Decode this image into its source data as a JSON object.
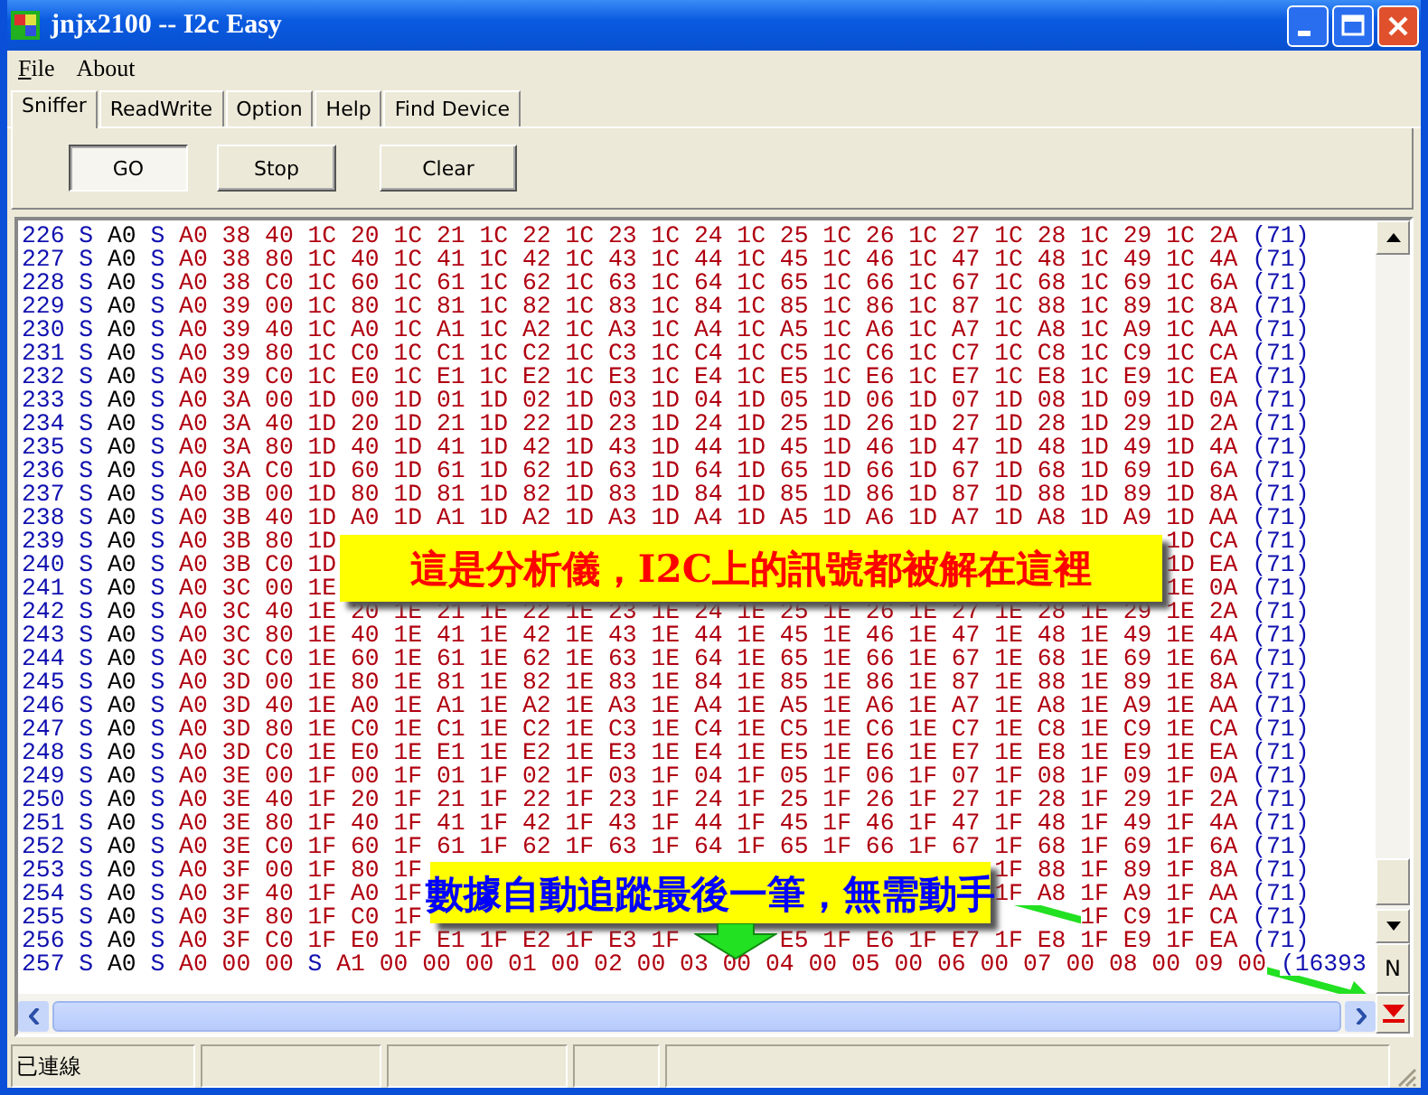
{
  "window": {
    "title": "jnjx2100 -- I2c Easy"
  },
  "menu": [
    {
      "label": "File",
      "underlined_first_letter": true
    },
    {
      "label": "About",
      "underlined_first_letter": false
    }
  ],
  "tabs": [
    {
      "label": "Sniffer",
      "selected": true
    },
    {
      "label": "ReadWrite",
      "selected": false
    },
    {
      "label": "Option",
      "selected": false
    },
    {
      "label": "Help",
      "selected": false
    },
    {
      "label": "Find Device",
      "selected": false
    }
  ],
  "buttons": [
    {
      "label": "GO",
      "pressed": true
    },
    {
      "label": "Stop",
      "pressed": false
    },
    {
      "label": "Clear",
      "pressed": false
    }
  ],
  "log": {
    "rows": [
      {
        "number": "226",
        "head": [
          {
            "kind": "mark",
            "text": "S"
          },
          {
            "kind": "address",
            "text": "A0"
          },
          {
            "kind": "mark",
            "text": "S"
          },
          {
            "kind": "data",
            "text": "A0 38 40 1C 20 1C 21 1C 22 1C 23 1C 24 1C 25 1C 26 1C 27 1C 28 1C 29 1C 2A"
          },
          {
            "kind": "count",
            "text": "(71)"
          }
        ]
      },
      {
        "number": "227",
        "head": [
          {
            "kind": "mark",
            "text": "S"
          },
          {
            "kind": "address",
            "text": "A0"
          },
          {
            "kind": "mark",
            "text": "S"
          },
          {
            "kind": "data",
            "text": "A0 38 80 1C 40 1C 41 1C 42 1C 43 1C 44 1C 45 1C 46 1C 47 1C 48 1C 49 1C 4A"
          },
          {
            "kind": "count",
            "text": "(71)"
          }
        ]
      },
      {
        "number": "228",
        "head": [
          {
            "kind": "mark",
            "text": "S"
          },
          {
            "kind": "address",
            "text": "A0"
          },
          {
            "kind": "mark",
            "text": "S"
          },
          {
            "kind": "data",
            "text": "A0 38 C0 1C 60 1C 61 1C 62 1C 63 1C 64 1C 65 1C 66 1C 67 1C 68 1C 69 1C 6A"
          },
          {
            "kind": "count",
            "text": "(71)"
          }
        ]
      },
      {
        "number": "229",
        "head": [
          {
            "kind": "mark",
            "text": "S"
          },
          {
            "kind": "address",
            "text": "A0"
          },
          {
            "kind": "mark",
            "text": "S"
          },
          {
            "kind": "data",
            "text": "A0 39 00 1C 80 1C 81 1C 82 1C 83 1C 84 1C 85 1C 86 1C 87 1C 88 1C 89 1C 8A"
          },
          {
            "kind": "count",
            "text": "(71)"
          }
        ]
      },
      {
        "number": "230",
        "head": [
          {
            "kind": "mark",
            "text": "S"
          },
          {
            "kind": "address",
            "text": "A0"
          },
          {
            "kind": "mark",
            "text": "S"
          },
          {
            "kind": "data",
            "text": "A0 39 40 1C A0 1C A1 1C A2 1C A3 1C A4 1C A5 1C A6 1C A7 1C A8 1C A9 1C AA"
          },
          {
            "kind": "count",
            "text": "(71)"
          }
        ]
      },
      {
        "number": "231",
        "head": [
          {
            "kind": "mark",
            "text": "S"
          },
          {
            "kind": "address",
            "text": "A0"
          },
          {
            "kind": "mark",
            "text": "S"
          },
          {
            "kind": "data",
            "text": "A0 39 80 1C C0 1C C1 1C C2 1C C3 1C C4 1C C5 1C C6 1C C7 1C C8 1C C9 1C CA"
          },
          {
            "kind": "count",
            "text": "(71)"
          }
        ]
      },
      {
        "number": "232",
        "head": [
          {
            "kind": "mark",
            "text": "S"
          },
          {
            "kind": "address",
            "text": "A0"
          },
          {
            "kind": "mark",
            "text": "S"
          },
          {
            "kind": "data",
            "text": "A0 39 C0 1C E0 1C E1 1C E2 1C E3 1C E4 1C E5 1C E6 1C E7 1C E8 1C E9 1C EA"
          },
          {
            "kind": "count",
            "text": "(71)"
          }
        ]
      },
      {
        "number": "233",
        "head": [
          {
            "kind": "mark",
            "text": "S"
          },
          {
            "kind": "address",
            "text": "A0"
          },
          {
            "kind": "mark",
            "text": "S"
          },
          {
            "kind": "data",
            "text": "A0 3A 00 1D 00 1D 01 1D 02 1D 03 1D 04 1D 05 1D 06 1D 07 1D 08 1D 09 1D 0A"
          },
          {
            "kind": "count",
            "text": "(71)"
          }
        ]
      },
      {
        "number": "234",
        "head": [
          {
            "kind": "mark",
            "text": "S"
          },
          {
            "kind": "address",
            "text": "A0"
          },
          {
            "kind": "mark",
            "text": "S"
          },
          {
            "kind": "data",
            "text": "A0 3A 40 1D 20 1D 21 1D 22 1D 23 1D 24 1D 25 1D 26 1D 27 1D 28 1D 29 1D 2A"
          },
          {
            "kind": "count",
            "text": "(71)"
          }
        ]
      },
      {
        "number": "235",
        "head": [
          {
            "kind": "mark",
            "text": "S"
          },
          {
            "kind": "address",
            "text": "A0"
          },
          {
            "kind": "mark",
            "text": "S"
          },
          {
            "kind": "data",
            "text": "A0 3A 80 1D 40 1D 41 1D 42 1D 43 1D 44 1D 45 1D 46 1D 47 1D 48 1D 49 1D 4A"
          },
          {
            "kind": "count",
            "text": "(71)"
          }
        ]
      },
      {
        "number": "236",
        "head": [
          {
            "kind": "mark",
            "text": "S"
          },
          {
            "kind": "address",
            "text": "A0"
          },
          {
            "kind": "mark",
            "text": "S"
          },
          {
            "kind": "data",
            "text": "A0 3A C0 1D 60 1D 61 1D 62 1D 63 1D 64 1D 65 1D 66 1D 67 1D 68 1D 69 1D 6A"
          },
          {
            "kind": "count",
            "text": "(71)"
          }
        ]
      },
      {
        "number": "237",
        "head": [
          {
            "kind": "mark",
            "text": "S"
          },
          {
            "kind": "address",
            "text": "A0"
          },
          {
            "kind": "mark",
            "text": "S"
          },
          {
            "kind": "data",
            "text": "A0 3B 00 1D 80 1D 81 1D 82 1D 83 1D 84 1D 85 1D 86 1D 87 1D 88 1D 89 1D 8A"
          },
          {
            "kind": "count",
            "text": "(71)"
          }
        ]
      },
      {
        "number": "238",
        "head": [
          {
            "kind": "mark",
            "text": "S"
          },
          {
            "kind": "address",
            "text": "A0"
          },
          {
            "kind": "mark",
            "text": "S"
          },
          {
            "kind": "data",
            "text": "A0 3B 40 1D A0 1D A1 1D A2 1D A3 1D A4 1D A5 1D A6 1D A7 1D A8 1D A9 1D AA"
          },
          {
            "kind": "count",
            "text": "(71)"
          }
        ]
      },
      {
        "number": "239",
        "head": [
          {
            "kind": "mark",
            "text": "S"
          },
          {
            "kind": "address",
            "text": "A0"
          },
          {
            "kind": "mark",
            "text": "S"
          },
          {
            "kind": "data",
            "text": "A0 3B 80 1D"
          }
        ],
        "tail": [
          {
            "kind": "data",
            "text": "1D CA"
          },
          {
            "kind": "count",
            "text": "(71)"
          }
        ]
      },
      {
        "number": "240",
        "head": [
          {
            "kind": "mark",
            "text": "S"
          },
          {
            "kind": "address",
            "text": "A0"
          },
          {
            "kind": "mark",
            "text": "S"
          },
          {
            "kind": "data",
            "text": "A0 3B C0 1D"
          }
        ],
        "tail": [
          {
            "kind": "data",
            "text": "1D EA"
          },
          {
            "kind": "count",
            "text": "(71)"
          }
        ]
      },
      {
        "number": "241",
        "head": [
          {
            "kind": "mark",
            "text": "S"
          },
          {
            "kind": "address",
            "text": "A0"
          },
          {
            "kind": "mark",
            "text": "S"
          },
          {
            "kind": "data",
            "text": "A0 3C 00 1E"
          }
        ],
        "tail": [
          {
            "kind": "data",
            "text": "1E 0A"
          },
          {
            "kind": "count",
            "text": "(71)"
          }
        ]
      },
      {
        "number": "242",
        "head": [
          {
            "kind": "mark",
            "text": "S"
          },
          {
            "kind": "address",
            "text": "A0"
          },
          {
            "kind": "mark",
            "text": "S"
          },
          {
            "kind": "data",
            "text": "A0 3C 40 1E 20 1E 21 1E 22 1E 23 1E 24 1E 25 1E 26 1E 27 1E 28 1E 29 1E 2A"
          },
          {
            "kind": "count",
            "text": "(71)"
          }
        ]
      },
      {
        "number": "243",
        "head": [
          {
            "kind": "mark",
            "text": "S"
          },
          {
            "kind": "address",
            "text": "A0"
          },
          {
            "kind": "mark",
            "text": "S"
          },
          {
            "kind": "data",
            "text": "A0 3C 80 1E 40 1E 41 1E 42 1E 43 1E 44 1E 45 1E 46 1E 47 1E 48 1E 49 1E 4A"
          },
          {
            "kind": "count",
            "text": "(71)"
          }
        ]
      },
      {
        "number": "244",
        "head": [
          {
            "kind": "mark",
            "text": "S"
          },
          {
            "kind": "address",
            "text": "A0"
          },
          {
            "kind": "mark",
            "text": "S"
          },
          {
            "kind": "data",
            "text": "A0 3C C0 1E 60 1E 61 1E 62 1E 63 1E 64 1E 65 1E 66 1E 67 1E 68 1E 69 1E 6A"
          },
          {
            "kind": "count",
            "text": "(71)"
          }
        ]
      },
      {
        "number": "245",
        "head": [
          {
            "kind": "mark",
            "text": "S"
          },
          {
            "kind": "address",
            "text": "A0"
          },
          {
            "kind": "mark",
            "text": "S"
          },
          {
            "kind": "data",
            "text": "A0 3D 00 1E 80 1E 81 1E 82 1E 83 1E 84 1E 85 1E 86 1E 87 1E 88 1E 89 1E 8A"
          },
          {
            "kind": "count",
            "text": "(71)"
          }
        ]
      },
      {
        "number": "246",
        "head": [
          {
            "kind": "mark",
            "text": "S"
          },
          {
            "kind": "address",
            "text": "A0"
          },
          {
            "kind": "mark",
            "text": "S"
          },
          {
            "kind": "data",
            "text": "A0 3D 40 1E A0 1E A1 1E A2 1E A3 1E A4 1E A5 1E A6 1E A7 1E A8 1E A9 1E AA"
          },
          {
            "kind": "count",
            "text": "(71)"
          }
        ]
      },
      {
        "number": "247",
        "head": [
          {
            "kind": "mark",
            "text": "S"
          },
          {
            "kind": "address",
            "text": "A0"
          },
          {
            "kind": "mark",
            "text": "S"
          },
          {
            "kind": "data",
            "text": "A0 3D 80 1E C0 1E C1 1E C2 1E C3 1E C4 1E C5 1E C6 1E C7 1E C8 1E C9 1E CA"
          },
          {
            "kind": "count",
            "text": "(71)"
          }
        ]
      },
      {
        "number": "248",
        "head": [
          {
            "kind": "mark",
            "text": "S"
          },
          {
            "kind": "address",
            "text": "A0"
          },
          {
            "kind": "mark",
            "text": "S"
          },
          {
            "kind": "data",
            "text": "A0 3D C0 1E E0 1E E1 1E E2 1E E3 1E E4 1E E5 1E E6 1E E7 1E E8 1E E9 1E EA"
          },
          {
            "kind": "count",
            "text": "(71)"
          }
        ]
      },
      {
        "number": "249",
        "head": [
          {
            "kind": "mark",
            "text": "S"
          },
          {
            "kind": "address",
            "text": "A0"
          },
          {
            "kind": "mark",
            "text": "S"
          },
          {
            "kind": "data",
            "text": "A0 3E 00 1F 00 1F 01 1F 02 1F 03 1F 04 1F 05 1F 06 1F 07 1F 08 1F 09 1F 0A"
          },
          {
            "kind": "count",
            "text": "(71)"
          }
        ]
      },
      {
        "number": "250",
        "head": [
          {
            "kind": "mark",
            "text": "S"
          },
          {
            "kind": "address",
            "text": "A0"
          },
          {
            "kind": "mark",
            "text": "S"
          },
          {
            "kind": "data",
            "text": "A0 3E 40 1F 20 1F 21 1F 22 1F 23 1F 24 1F 25 1F 26 1F 27 1F 28 1F 29 1F 2A"
          },
          {
            "kind": "count",
            "text": "(71)"
          }
        ]
      },
      {
        "number": "251",
        "head": [
          {
            "kind": "mark",
            "text": "S"
          },
          {
            "kind": "address",
            "text": "A0"
          },
          {
            "kind": "mark",
            "text": "S"
          },
          {
            "kind": "data",
            "text": "A0 3E 80 1F 40 1F 41 1F 42 1F 43 1F 44 1F 45 1F 46 1F 47 1F 48 1F 49 1F 4A"
          },
          {
            "kind": "count",
            "text": "(71)"
          }
        ]
      },
      {
        "number": "252",
        "head": [
          {
            "kind": "mark",
            "text": "S"
          },
          {
            "kind": "address",
            "text": "A0"
          },
          {
            "kind": "mark",
            "text": "S"
          },
          {
            "kind": "data",
            "text": "A0 3E C0 1F 60 1F 61 1F 62 1F 63 1F 64 1F 65 1F 66 1F 67 1F 68 1F 69 1F 6A"
          },
          {
            "kind": "count",
            "text": "(71)"
          }
        ]
      },
      {
        "number": "253",
        "head": [
          {
            "kind": "mark",
            "text": "S"
          },
          {
            "kind": "address",
            "text": "A0"
          },
          {
            "kind": "mark",
            "text": "S"
          },
          {
            "kind": "data",
            "text": "A0 3F 00 1F 80 1F"
          }
        ],
        "tail": [
          {
            "kind": "data",
            "text": "1F 88 1F 89 1F 8A"
          },
          {
            "kind": "count",
            "text": "(71)"
          }
        ]
      },
      {
        "number": "254",
        "head": [
          {
            "kind": "mark",
            "text": "S"
          },
          {
            "kind": "address",
            "text": "A0"
          },
          {
            "kind": "mark",
            "text": "S"
          },
          {
            "kind": "data",
            "text": "A0 3F 40 1F A0 1F"
          }
        ],
        "tail": [
          {
            "kind": "data",
            "text": "1F A8 1F A9 1F AA"
          },
          {
            "kind": "count",
            "text": "(71)"
          }
        ]
      },
      {
        "number": "255",
        "head": [
          {
            "kind": "mark",
            "text": "S"
          },
          {
            "kind": "address",
            "text": "A0"
          },
          {
            "kind": "mark",
            "text": "S"
          },
          {
            "kind": "data",
            "text": "A0 3F 80 1F C0 1F"
          }
        ],
        "tail": [
          {
            "kind": "data",
            "text": "1F C9 1F CA"
          },
          {
            "kind": "count",
            "text": "(71)"
          }
        ]
      },
      {
        "number": "256",
        "head": [
          {
            "kind": "mark",
            "text": "S"
          },
          {
            "kind": "address",
            "text": "A0"
          },
          {
            "kind": "mark",
            "text": "S"
          },
          {
            "kind": "data",
            "text": "A0 3F C0 1F E0 1F E1 1F E2 1F E3 1F"
          }
        ],
        "tail": [
          {
            "kind": "data",
            "text": "E5 1F E6 1F E7 1F E8 1F E9 1F EA"
          },
          {
            "kind": "count",
            "text": "(71)"
          }
        ]
      },
      {
        "number": "257",
        "head": [
          {
            "kind": "mark",
            "text": "S"
          },
          {
            "kind": "address",
            "text": "A0"
          },
          {
            "kind": "mark",
            "text": "S"
          },
          {
            "kind": "data",
            "text": "A0 00 00"
          },
          {
            "kind": "mark",
            "text": "S"
          },
          {
            "kind": "data",
            "text": "A1 00 00 00 01 00 02 00 03 00 04 00 05 00 06 00 07 00 08 00 09 00"
          },
          {
            "kind": "count",
            "text": "(16393"
          }
        ]
      }
    ],
    "side_button": "N"
  },
  "callouts": [
    {
      "text": "這是分析儀，I2C上的訊號都被解在這裡",
      "color": "#ff0000"
    },
    {
      "text": "數據自動追蹤最後一筆，無需動手",
      "color": "#0000ff"
    }
  ],
  "status_bar": [
    "已連線"
  ]
}
